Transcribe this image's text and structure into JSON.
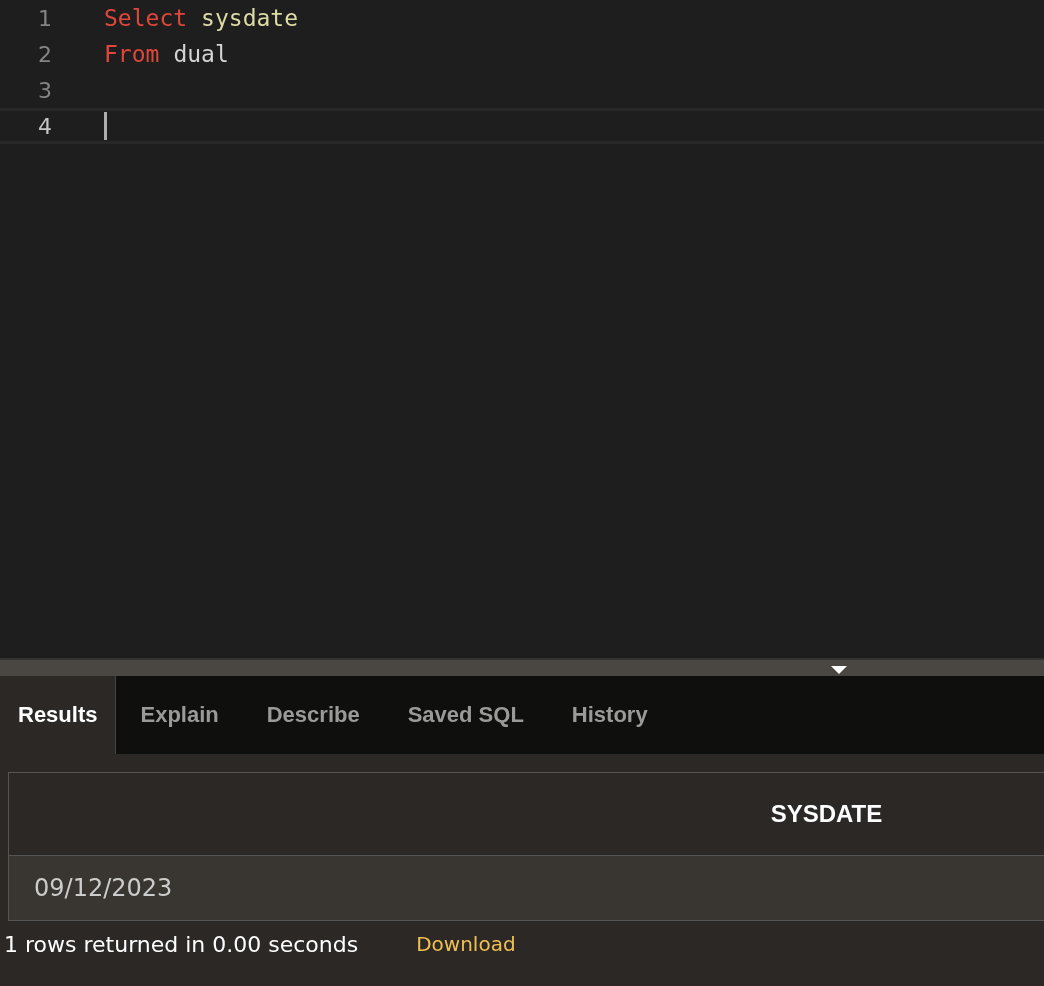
{
  "editor": {
    "lines": [
      {
        "number": "1",
        "current": false,
        "tokens": [
          {
            "text": "Select",
            "kind": "keyword"
          },
          {
            "text": "sysdate",
            "kind": "function"
          }
        ]
      },
      {
        "number": "2",
        "current": false,
        "tokens": [
          {
            "text": "From",
            "kind": "keyword"
          },
          {
            "text": "dual",
            "kind": "identifier"
          }
        ]
      },
      {
        "number": "3",
        "current": false
      },
      {
        "number": "4",
        "current": true
      }
    ]
  },
  "tabs": [
    {
      "label": "Results",
      "selected": true
    },
    {
      "label": "Explain",
      "selected": false
    },
    {
      "label": "Describe",
      "selected": false
    },
    {
      "label": "Saved SQL",
      "selected": false
    },
    {
      "label": "History",
      "selected": false
    }
  ],
  "table": {
    "columns": [
      "SYSDATE"
    ],
    "rows": [
      [
        "09/12/2023"
      ]
    ]
  },
  "status": {
    "message": "1 rows returned in 0.00 seconds",
    "download": "Download"
  }
}
